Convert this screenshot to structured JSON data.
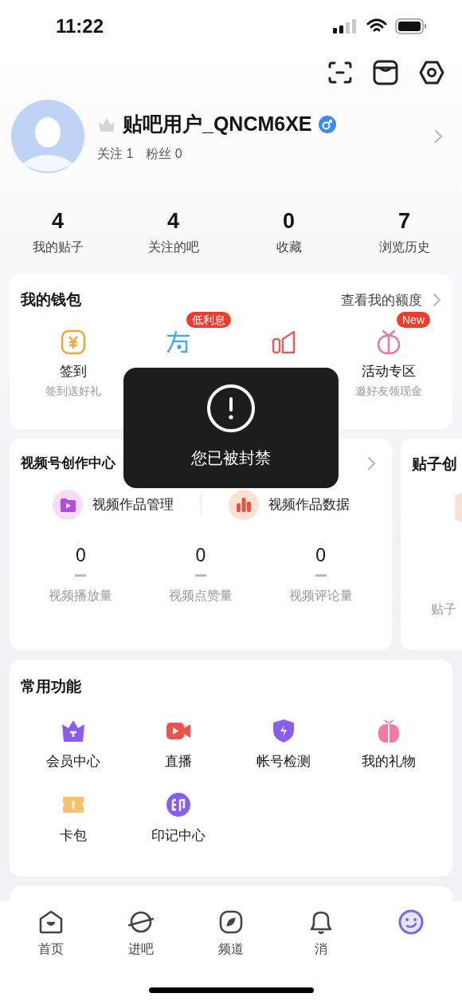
{
  "status_bar": {
    "time": "11:22"
  },
  "profile": {
    "name": "贴吧用户_QNCM6XE",
    "following": "关注 1",
    "fans": "粉丝 0"
  },
  "stats": [
    {
      "value": "4",
      "label": "我的贴子"
    },
    {
      "value": "4",
      "label": "关注的吧"
    },
    {
      "value": "0",
      "label": "收藏"
    },
    {
      "value": "7",
      "label": "浏览历史"
    }
  ],
  "wallet": {
    "title": "我的钱包",
    "link": "查看我的额度",
    "items": [
      {
        "kind": "yen",
        "title": "签到",
        "subtitle": "签到送好礼"
      },
      {
        "kind": "you",
        "badge": "低利息"
      },
      {
        "kind": "bars"
      },
      {
        "kind": "gift",
        "title": "活动专区",
        "subtitle": "邀好友领现金",
        "badge": "New"
      }
    ]
  },
  "creation": {
    "title": "视频号创作中心",
    "actions": [
      {
        "kind": "video",
        "label": "视频作品管理"
      },
      {
        "kind": "chart",
        "label": "视频作品数据"
      }
    ],
    "metrics": [
      {
        "value": "0",
        "label": "视频播放量"
      },
      {
        "value": "0",
        "label": "视频点赞量"
      },
      {
        "value": "0",
        "label": "视频评论量"
      }
    ],
    "next_card": {
      "title": "贴子创",
      "metric_label": "贴子"
    }
  },
  "functions": {
    "title": "常用功能",
    "items": [
      {
        "kind": "crown",
        "label": "会员中心"
      },
      {
        "kind": "live",
        "label": "直播"
      },
      {
        "kind": "shield",
        "label": "帐号检测"
      },
      {
        "kind": "present",
        "label": "我的礼物"
      },
      {
        "kind": "ticket",
        "label": "卡包"
      },
      {
        "kind": "seal",
        "label": "印记中心"
      }
    ]
  },
  "toast": {
    "message": "您已被封禁"
  },
  "tabs": [
    {
      "kind": "home",
      "label": "首页",
      "selected": false
    },
    {
      "kind": "planet",
      "label": "进吧",
      "selected": false
    },
    {
      "kind": "compass",
      "label": "频道",
      "selected": false
    },
    {
      "kind": "bell",
      "label": "消",
      "selected": false
    },
    {
      "kind": "face",
      "selected": true
    }
  ]
}
